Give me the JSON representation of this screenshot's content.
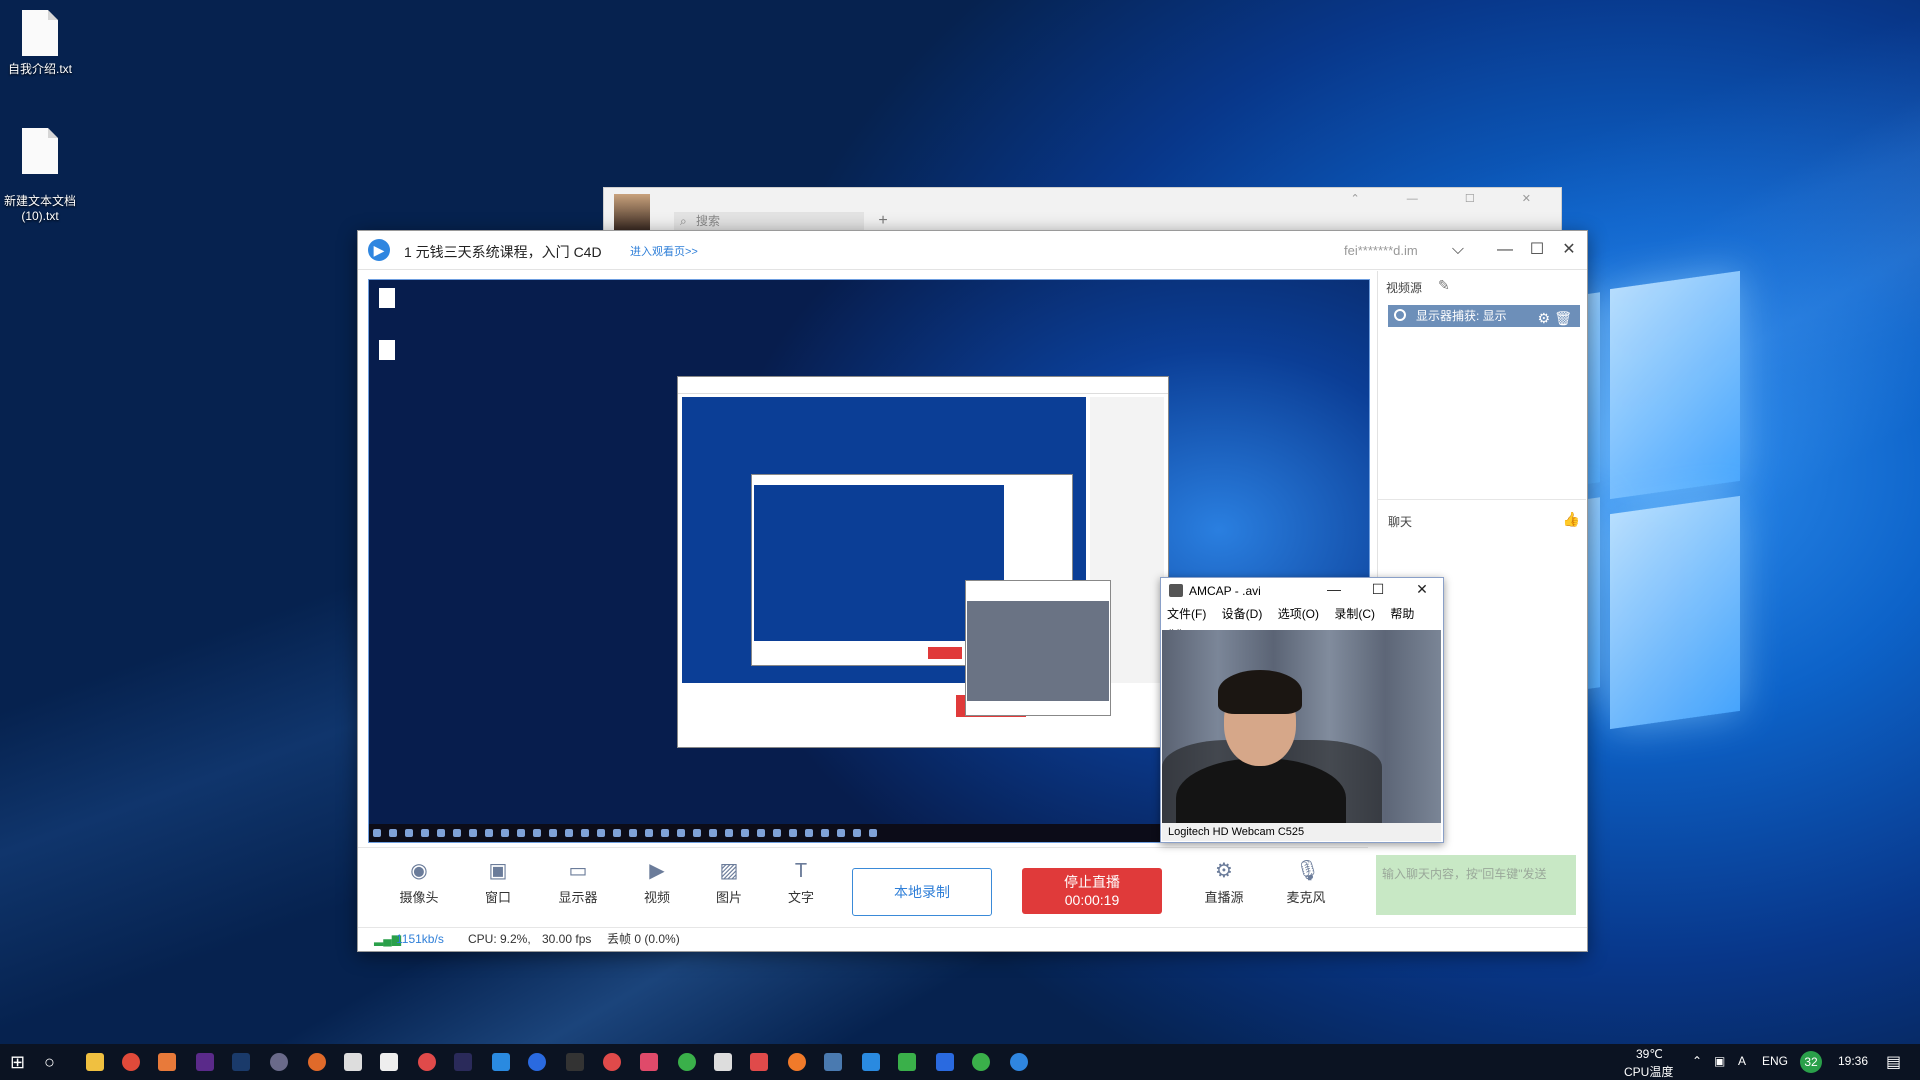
{
  "desktop": {
    "icons": [
      {
        "label": "自我介绍.txt"
      },
      {
        "label": "新建文本文档\n(10).txt"
      }
    ]
  },
  "back_window": {
    "search_placeholder": "搜索",
    "plus": "+"
  },
  "main_window": {
    "title": "1 元钱三天系统课程，入门 C4D",
    "enter_link": "进入观看页>>",
    "user": "fei*******d.im",
    "controls": {
      "dropdown": "⌵",
      "minimize": "—",
      "maximize": "☐",
      "close": "✕"
    }
  },
  "side_panel": {
    "sources_label": "视频源",
    "source_item": "显示器捕获: 显示",
    "chat_label": "聊天",
    "chat_input_placeholder": "输入聊天内容，按\"回车键\"发送"
  },
  "toolbar": {
    "tools": [
      {
        "label": "摄像头",
        "icon": "camera-icon"
      },
      {
        "label": "窗口",
        "icon": "window-icon"
      },
      {
        "label": "显示器",
        "icon": "monitor-icon"
      },
      {
        "label": "视频",
        "icon": "video-icon"
      },
      {
        "label": "图片",
        "icon": "image-icon"
      },
      {
        "label": "文字",
        "icon": "text-icon"
      }
    ],
    "local_record": "本地录制",
    "stop_live": "停止直播",
    "live_time": "00:00:19",
    "source_label": "直播源",
    "mic_label": "麦克风"
  },
  "status_bar": {
    "bitrate": "1151kb/s",
    "cpu": "CPU: 9.2%,",
    "fps": "30.00 fps",
    "dropped": "丢帧 0 (0.0%)"
  },
  "amcap": {
    "title": "AMCAP - .avi",
    "menu": [
      "文件(F)",
      "设备(D)",
      "选项(O)",
      "录制(C)",
      "帮助(H)"
    ],
    "caption": "Logitech HD Webcam C525"
  },
  "taskbar": {
    "temp": "39℃",
    "temp_label": "CPU温度",
    "lang": "ENG",
    "badge": "32",
    "time": "19:36"
  },
  "colors": {
    "accent": "#2f7fd8",
    "live_red": "#e03a3a",
    "source_item": "#6d8fb9",
    "chat_input_bg": "#c8e8c5"
  }
}
